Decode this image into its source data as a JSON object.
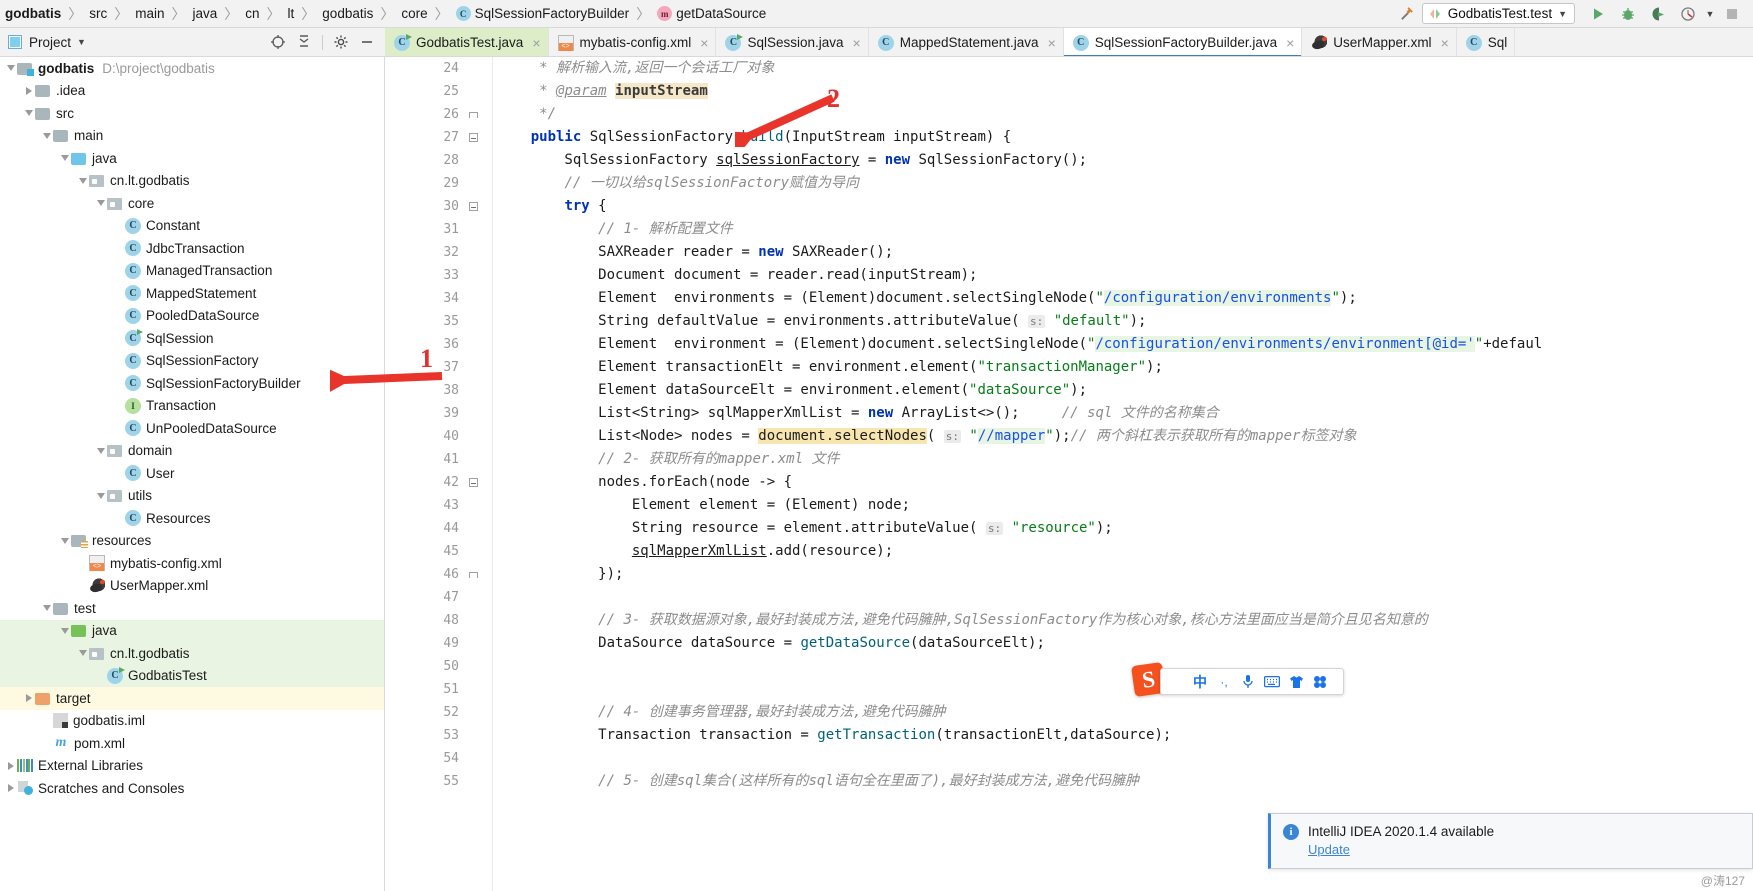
{
  "navbar": {
    "crumbs": [
      {
        "label": "godbatis",
        "icon": "none",
        "bold": true
      },
      {
        "label": "src",
        "icon": "none"
      },
      {
        "label": "main",
        "icon": "none"
      },
      {
        "label": "java",
        "icon": "none"
      },
      {
        "label": "cn",
        "icon": "none"
      },
      {
        "label": "lt",
        "icon": "none"
      },
      {
        "label": "godbatis",
        "icon": "none"
      },
      {
        "label": "core",
        "icon": "none"
      },
      {
        "label": "SqlSessionFactoryBuilder",
        "icon": "class-icon",
        "glyph": "C"
      },
      {
        "label": "getDataSource",
        "icon": "method-icon",
        "glyph": "m"
      }
    ],
    "run_config": "GodbatisTest.test",
    "buttons": {
      "build": "build-hammer-icon",
      "run": "run-icon",
      "debug": "debug-icon",
      "run_coverage": "run-with-coverage-icon",
      "profile": "profiler-icon",
      "stop": "stop-icon"
    }
  },
  "project_panel": {
    "title": "Project",
    "actions": [
      "locate-icon",
      "collapse-all-icon",
      "settings-gear-icon",
      "hide-icon"
    ],
    "tree": [
      {
        "indent": 0,
        "twisty": "down",
        "icon": "folder-module",
        "label": "godbatis",
        "bold": true,
        "sub": "D:\\project\\godbatis"
      },
      {
        "indent": 1,
        "twisty": "right",
        "icon": "folder-gray",
        "label": ".idea"
      },
      {
        "indent": 1,
        "twisty": "down",
        "icon": "folder-gray",
        "label": "src"
      },
      {
        "indent": 2,
        "twisty": "down",
        "icon": "folder-gray",
        "label": "main"
      },
      {
        "indent": 3,
        "twisty": "down",
        "icon": "folder-blue",
        "label": "java"
      },
      {
        "indent": 4,
        "twisty": "down",
        "icon": "package",
        "label": "cn.lt.godbatis"
      },
      {
        "indent": 5,
        "twisty": "down",
        "icon": "package",
        "label": "core"
      },
      {
        "indent": 6,
        "twisty": "none",
        "icon": "class",
        "label": "Constant"
      },
      {
        "indent": 6,
        "twisty": "none",
        "icon": "class",
        "label": "JdbcTransaction"
      },
      {
        "indent": 6,
        "twisty": "none",
        "icon": "class",
        "label": "ManagedTransaction"
      },
      {
        "indent": 6,
        "twisty": "none",
        "icon": "class",
        "label": "MappedStatement"
      },
      {
        "indent": 6,
        "twisty": "none",
        "icon": "class",
        "label": "PooledDataSource"
      },
      {
        "indent": 6,
        "twisty": "none",
        "icon": "class-runnable",
        "label": "SqlSession"
      },
      {
        "indent": 6,
        "twisty": "none",
        "icon": "class",
        "label": "SqlSessionFactory"
      },
      {
        "indent": 6,
        "twisty": "none",
        "icon": "class",
        "label": "SqlSessionFactoryBuilder"
      },
      {
        "indent": 6,
        "twisty": "none",
        "icon": "interface",
        "label": "Transaction"
      },
      {
        "indent": 6,
        "twisty": "none",
        "icon": "class",
        "label": "UnPooledDataSource"
      },
      {
        "indent": 5,
        "twisty": "down",
        "icon": "package",
        "label": "domain"
      },
      {
        "indent": 6,
        "twisty": "none",
        "icon": "class",
        "label": "User"
      },
      {
        "indent": 5,
        "twisty": "down",
        "icon": "package",
        "label": "utils"
      },
      {
        "indent": 6,
        "twisty": "none",
        "icon": "class",
        "label": "Resources"
      },
      {
        "indent": 3,
        "twisty": "down",
        "icon": "folder-resources",
        "label": "resources"
      },
      {
        "indent": 4,
        "twisty": "none",
        "icon": "xml",
        "label": "mybatis-config.xml"
      },
      {
        "indent": 4,
        "twisty": "none",
        "icon": "bird",
        "label": "UserMapper.xml"
      },
      {
        "indent": 2,
        "twisty": "down",
        "icon": "folder-gray",
        "label": "test"
      },
      {
        "indent": 3,
        "twisty": "down",
        "icon": "folder-green",
        "label": "java",
        "highlight": "green"
      },
      {
        "indent": 4,
        "twisty": "down",
        "icon": "package",
        "label": "cn.lt.godbatis",
        "highlight": "green"
      },
      {
        "indent": 5,
        "twisty": "none",
        "icon": "class-runnable",
        "label": "GodbatisTest",
        "highlight": "green"
      },
      {
        "indent": 1,
        "twisty": "right",
        "icon": "folder-orange",
        "label": "target",
        "highlight": "yellow"
      },
      {
        "indent": 2,
        "twisty": "none",
        "icon": "iml",
        "label": "godbatis.iml"
      },
      {
        "indent": 2,
        "twisty": "none",
        "icon": "maven",
        "label": "pom.xml"
      },
      {
        "indent": 0,
        "twisty": "right",
        "icon": "library",
        "label": "External Libraries"
      },
      {
        "indent": 0,
        "twisty": "right",
        "icon": "scratches",
        "label": "Scratches and Consoles"
      }
    ]
  },
  "editor_tabs": [
    {
      "label": "GodbatisTest.java",
      "icon": "class-runnable",
      "state": "green",
      "close": "×"
    },
    {
      "label": "mybatis-config.xml",
      "icon": "xml",
      "state": "normal",
      "close": "×"
    },
    {
      "label": "SqlSession.java",
      "icon": "class-runnable",
      "state": "normal",
      "close": "×"
    },
    {
      "label": "MappedStatement.java",
      "icon": "class",
      "state": "normal",
      "close": "×"
    },
    {
      "label": "SqlSessionFactoryBuilder.java",
      "icon": "class",
      "state": "selected",
      "close": "×"
    },
    {
      "label": "UserMapper.xml",
      "icon": "bird",
      "state": "normal",
      "close": "×"
    },
    {
      "label": "Sql",
      "icon": "class",
      "state": "normal",
      "close": ""
    }
  ],
  "editor": {
    "first_line": 24,
    "lines": [
      {
        "n": 24,
        "fold": "none"
      },
      {
        "n": 25,
        "fold": "none"
      },
      {
        "n": 26,
        "fold": "cap"
      },
      {
        "n": 27,
        "fold": "box"
      },
      {
        "n": 28,
        "fold": "none"
      },
      {
        "n": 29,
        "fold": "none"
      },
      {
        "n": 30,
        "fold": "box"
      },
      {
        "n": 31,
        "fold": "none"
      },
      {
        "n": 32,
        "fold": "none"
      },
      {
        "n": 33,
        "fold": "none"
      },
      {
        "n": 34,
        "fold": "none"
      },
      {
        "n": 35,
        "fold": "none"
      },
      {
        "n": 36,
        "fold": "none"
      },
      {
        "n": 37,
        "fold": "none"
      },
      {
        "n": 38,
        "fold": "none"
      },
      {
        "n": 39,
        "fold": "none"
      },
      {
        "n": 40,
        "fold": "none"
      },
      {
        "n": 41,
        "fold": "none"
      },
      {
        "n": 42,
        "fold": "box"
      },
      {
        "n": 43,
        "fold": "none"
      },
      {
        "n": 44,
        "fold": "none"
      },
      {
        "n": 45,
        "fold": "none"
      },
      {
        "n": 46,
        "fold": "cap"
      },
      {
        "n": 47,
        "fold": "none"
      },
      {
        "n": 48,
        "fold": "none"
      },
      {
        "n": 49,
        "fold": "none"
      },
      {
        "n": 50,
        "fold": "none"
      },
      {
        "n": 51,
        "fold": "none"
      },
      {
        "n": 52,
        "fold": "none"
      },
      {
        "n": 53,
        "fold": "none"
      },
      {
        "n": 54,
        "fold": "none"
      },
      {
        "n": 55,
        "fold": "none"
      }
    ],
    "code_text": [
      "     * 解析输入流,返回一个会话工厂对象",
      "     * @param inputStream",
      "     */",
      "    public SqlSessionFactory build(InputStream inputStream) {",
      "        SqlSessionFactory sqlSessionFactory = new SqlSessionFactory();",
      "        // 一切以给sqlSessionFactory赋值为导向",
      "        try {",
      "            // 1- 解析配置文件",
      "            SAXReader reader = new SAXReader();",
      "            Document document = reader.read(inputStream);",
      "            Element  environments = (Element)document.selectSingleNode(\"/configuration/environments\");",
      "            String defaultValue = environments.attributeValue( s: \"default\");",
      "            Element  environment = (Element)document.selectSingleNode(\"/configuration/environments/environment[@id='\"+defaul",
      "            Element transactionElt = environment.element(\"transactionManager\");",
      "            Element dataSourceElt = environment.element(\"dataSource\");",
      "            List<String> sqlMapperXmlList = new ArrayList<>();     // sql 文件的名称集合",
      "            List<Node> nodes = document.selectNodes( s: \"//mapper\");// 两个斜杠表示获取所有的mapper标签对象",
      "            // 2- 获取所有的mapper.xml 文件",
      "            nodes.forEach(node -> {",
      "                Element element = (Element) node;",
      "                String resource = element.attributeValue( s: \"resource\");",
      "                sqlMapperXmlList.add(resource);",
      "            });",
      "",
      "            // 3- 获取数据源对象,最好封装成方法,避免代码臃肿,SqlSessionFactory作为核心对象,核心方法里面应当是简介且见名知意的",
      "            DataSource dataSource = getDataSource(dataSourceElt);",
      "",
      "",
      "            // 4- 创建事务管理器,最好封装成方法,避免代码臃肿",
      "            Transaction transaction = getTransaction(transactionElt,dataSource);",
      "",
      "            // 5- 创建sql集合(这样所有的sql语句全在里面了),最好封装成方法,避免代码臃肿"
    ]
  },
  "annotations": [
    {
      "label": "1",
      "type": "number-with-arrow",
      "target": "SqlSessionFactoryBuilder tree node"
    },
    {
      "label": "2",
      "type": "number-with-arrow",
      "target": "build method declaration"
    }
  ],
  "ime_bar": {
    "logo": "S",
    "items": [
      "中",
      "·,",
      "mic-icon",
      "keyboard-icon",
      "skin-icon",
      "apps-icon"
    ]
  },
  "notification": {
    "icon": "info-icon",
    "title": "IntelliJ IDEA 2020.1.4 available",
    "link": "Update"
  },
  "watermark": "@涛127"
}
